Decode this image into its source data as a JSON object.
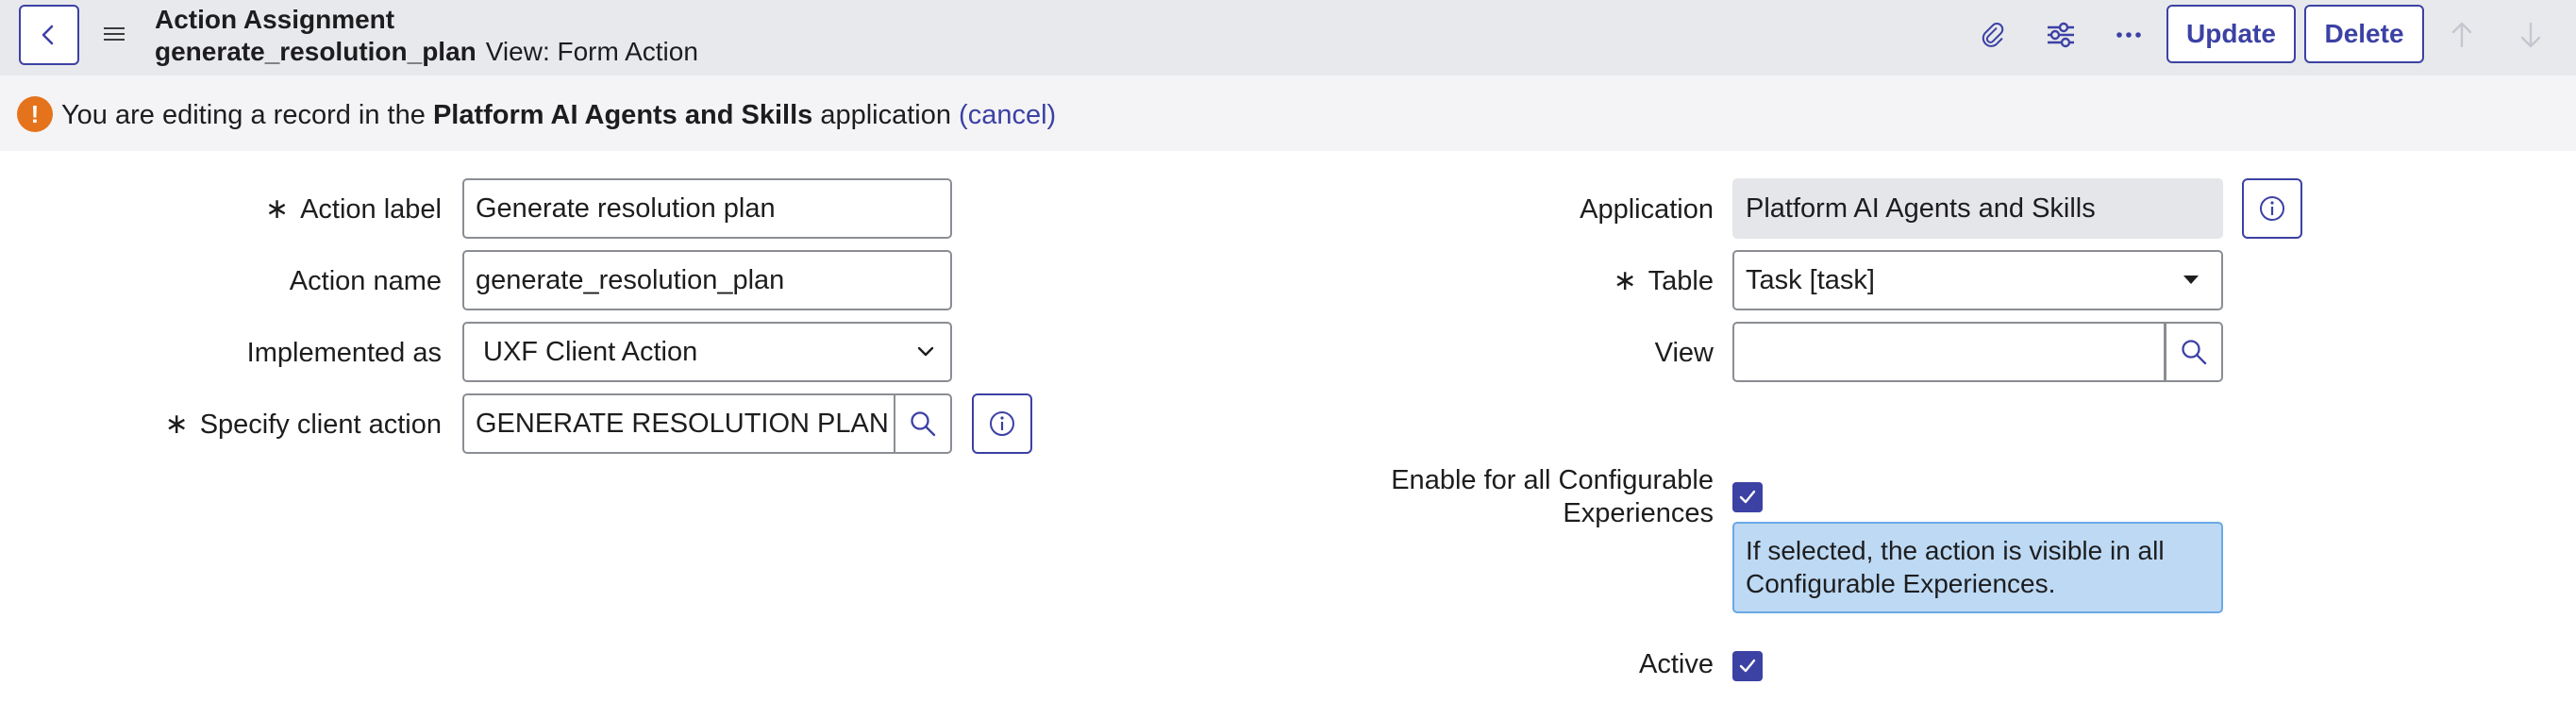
{
  "header": {
    "title": "Action Assignment",
    "record_name": "generate_resolution_plan",
    "view_label": "View: Form Action",
    "update_label": "Update",
    "delete_label": "Delete"
  },
  "banner": {
    "prefix": "You are editing a record in the",
    "app_name": "Platform AI Agents and Skills",
    "suffix": "application",
    "cancel_label": "(cancel)",
    "icon_text": "!"
  },
  "form": {
    "action_label": {
      "label": "Action label",
      "value": "Generate resolution plan",
      "required": true
    },
    "action_name": {
      "label": "Action name",
      "value": "generate_resolution_plan"
    },
    "implemented_as": {
      "label": "Implemented as",
      "value": "UXF Client Action"
    },
    "client_action": {
      "label": "Specify client action",
      "value": "GENERATE RESOLUTION PLAN",
      "required": true
    },
    "application": {
      "label": "Application",
      "value": "Platform AI Agents and Skills"
    },
    "table": {
      "label": "Table",
      "value": "Task [task]",
      "required": true
    },
    "view": {
      "label": "View",
      "value": ""
    },
    "enable_all": {
      "label_line1": "Enable for all Configurable",
      "label_line2": "Experiences",
      "checked": true,
      "hint_line1": "If selected, the action is visible in all",
      "hint_line2": "Configurable Experiences."
    },
    "active": {
      "label": "Active",
      "checked": true
    },
    "required_marker": "∗"
  },
  "colors": {
    "accent": "#3c41a4",
    "header_bg": "#e8e9ec",
    "banner_bg": "#f4f4f6",
    "warning": "#e5731c",
    "hint_bg": "#bdd9f3"
  },
  "icons": [
    "back-icon",
    "menu-icon",
    "attachment-icon",
    "settings-sliders-icon",
    "more-icon",
    "arrow-up-icon",
    "arrow-down-icon",
    "warning-icon",
    "search-icon",
    "info-icon",
    "chevron-down-icon",
    "caret-down-icon",
    "checkmark-icon"
  ]
}
